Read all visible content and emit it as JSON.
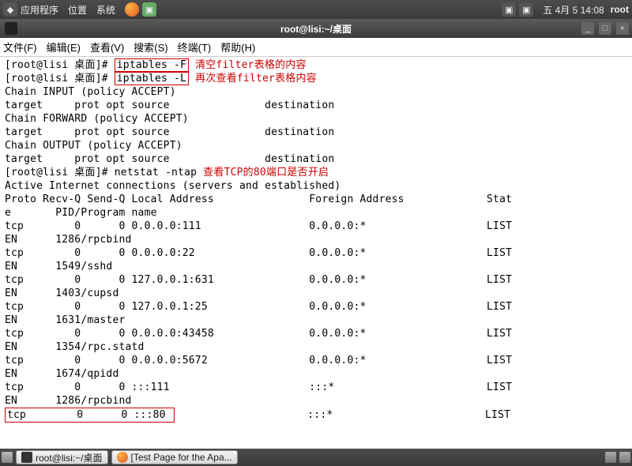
{
  "topbar": {
    "apps": "应用程序",
    "places": "位置",
    "system": "系统",
    "date": "五  4月  5 14:08",
    "user": "root"
  },
  "window": {
    "title": "root@lisi:~/桌面"
  },
  "menubar": {
    "file": "文件(F)",
    "edit": "编辑(E)",
    "view": "查看(V)",
    "search": "搜索(S)",
    "terminal": "终端(T)",
    "help": "帮助(H)"
  },
  "term": {
    "prompt": "[root@lisi 桌面]# ",
    "cmd1": "iptables -F",
    "ann1": " 清空filter表格的内容",
    "cmd2": "iptables -L",
    "ann2": " 再次查看filter表格内容",
    "l1": "Chain INPUT (policy ACCEPT)",
    "l2": "target     prot opt source               destination",
    "blank": "",
    "l3": "Chain FORWARD (policy ACCEPT)",
    "l4": "target     prot opt source               destination",
    "l5": "Chain OUTPUT (policy ACCEPT)",
    "l6": "target     prot opt source               destination",
    "cmd3": "netstat -ntap",
    "ann3": " 查看TCP的80端口是否开启",
    "l7": "Active Internet connections (servers and established)",
    "l8": "Proto Recv-Q Send-Q Local Address               Foreign Address             Stat",
    "l9": "e       PID/Program name",
    "r1a": "tcp        0      0 0.0.0.0:111                 0.0.0.0:*                   LIST",
    "r1b": "EN      1286/rpcbind",
    "r2a": "tcp        0      0 0.0.0.0:22                  0.0.0.0:*                   LIST",
    "r2b": "EN      1549/sshd",
    "r3a": "tcp        0      0 127.0.0.1:631               0.0.0.0:*                   LIST",
    "r3b": "EN      1403/cupsd",
    "r4a": "tcp        0      0 127.0.0.1:25                0.0.0.0:*                   LIST",
    "r4b": "EN      1631/master",
    "r5a": "tcp        0      0 0.0.0.0:43458               0.0.0.0:*                   LIST",
    "r5b": "EN      1354/rpc.statd",
    "r6a": "tcp        0      0 0.0.0.0:5672                0.0.0.0:*                   LIST",
    "r6b": "EN      1674/qpidd",
    "r7a": "tcp        0      0 :::111                      :::*                        LIST",
    "r7b": "EN      1286/rpcbind",
    "r8a": "tcp        0      0 :::80 ",
    "r8mid": "                     :::*                        LIST"
  },
  "taskbar": {
    "task1": "root@lisi:~/桌面",
    "task2": "[Test Page for the Apa..."
  }
}
